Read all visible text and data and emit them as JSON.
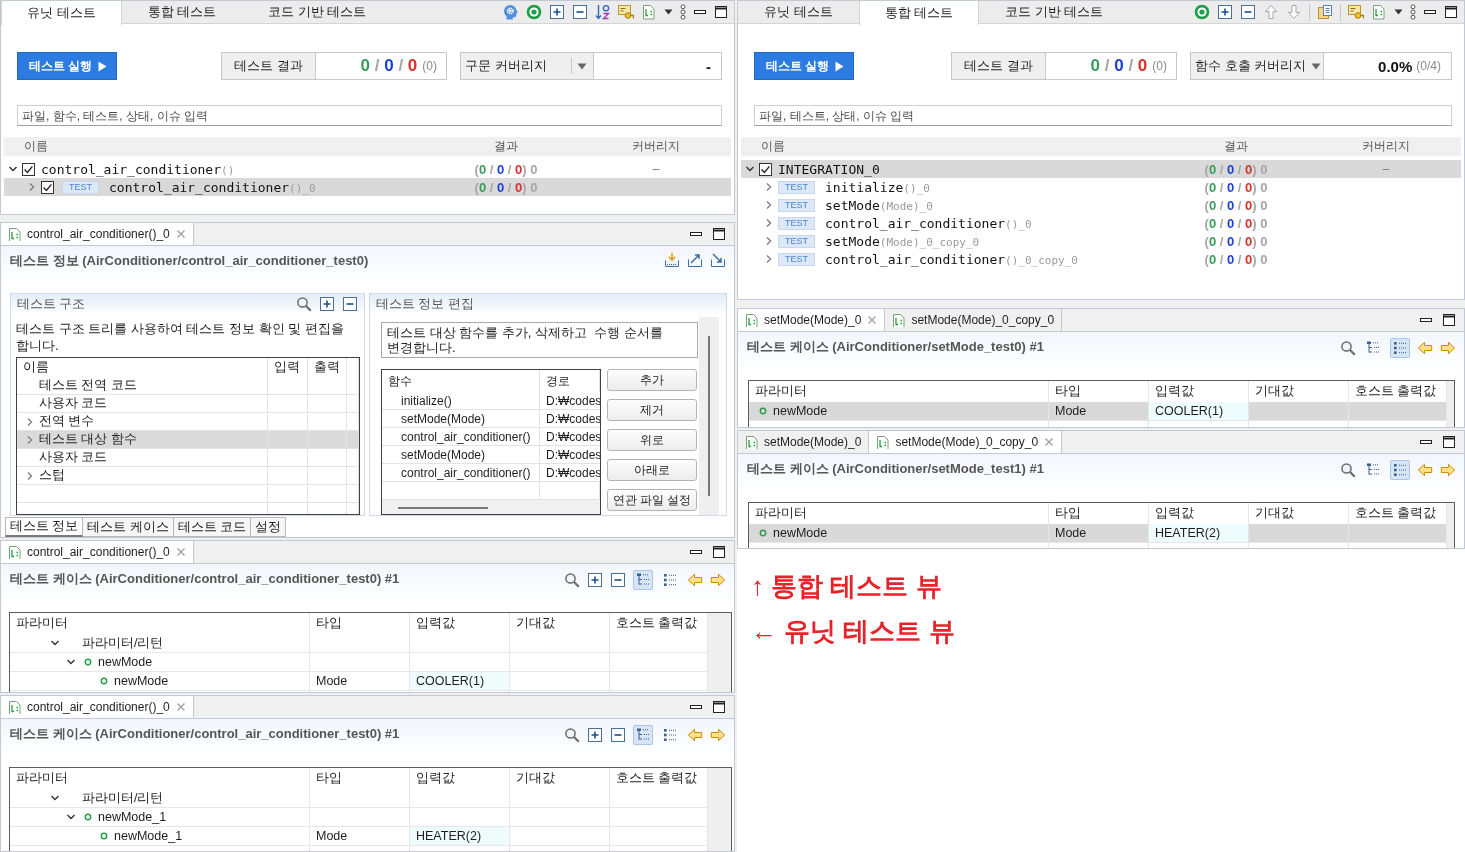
{
  "unit_view": {
    "tabs": [
      {
        "label": "유닛 테스트",
        "selected": true
      },
      {
        "label": "통합 테스트",
        "selected": false
      },
      {
        "label": "코드 기반 테스트",
        "selected": false
      }
    ],
    "run_button": "테스트 실행",
    "result": {
      "label": "테스트 결과",
      "counts": [
        {
          "text": "0",
          "color": "#3a9b5b"
        },
        {
          "text": " / ",
          "color": "#a6a6a6"
        },
        {
          "text": "0",
          "color": "#1d3fd6"
        },
        {
          "text": " / ",
          "color": "#a6a6a6"
        },
        {
          "text": "0",
          "color": "#d8312d"
        }
      ],
      "total": "(0)"
    },
    "coverage": {
      "label": "구문 커버리지",
      "value": "-"
    },
    "search": {
      "placeholder": "파일, 함수, 테스트, 상태, 이슈 입력"
    },
    "tree": {
      "columns": [
        "이름",
        "결과",
        "커버리지"
      ],
      "rows": [
        {
          "name": "control_air_conditioner",
          "suffix": "()",
          "checked": true,
          "expanded": true,
          "selected": false,
          "result": [
            {
              "text": "(",
              "color": "#a6a6a6"
            },
            {
              "text": "0",
              "color": "#3a9b5b"
            },
            {
              "text": " / ",
              "color": "#a6a6a6"
            },
            {
              "text": "0",
              "color": "#1d3fd6"
            },
            {
              "text": " / ",
              "color": "#a6a6a6"
            },
            {
              "text": "0",
              "color": "#d8312d"
            },
            {
              "text": ") 0",
              "color": "#a6a6a6"
            }
          ],
          "coverage": "–",
          "children": [
            {
              "badge": "TEST",
              "name": "control_air_conditioner",
              "suffix": "()_0",
              "checked": true,
              "expanded": false,
              "selected": true,
              "result": [
                {
                  "text": "(",
                  "color": "#a6a6a6"
                },
                {
                  "text": "0",
                  "color": "#3a9b5b"
                },
                {
                  "text": " / ",
                  "color": "#a6a6a6"
                },
                {
                  "text": "0",
                  "color": "#1d3fd6"
                },
                {
                  "text": " / ",
                  "color": "#a6a6a6"
                },
                {
                  "text": "0",
                  "color": "#d8312d"
                },
                {
                  "text": ") 0",
                  "color": "#a6a6a6"
                }
              ]
            }
          ]
        }
      ]
    }
  },
  "test_info_editor": {
    "tabs": [
      {
        "label": "control_air_conditioner()_0",
        "selected": true
      }
    ],
    "title": "테스트 정보 (AirConditioner/control_air_conditioner_test0)",
    "structure": {
      "title": "테스트 구조",
      "description": "테스트 구조 트리를 사용하여 테스트 정보 확인 및 편집을 합니다.",
      "columns": [
        "이름",
        "입력",
        "출력"
      ],
      "rows": [
        {
          "label": "테스트 전역 코드",
          "selected": false
        },
        {
          "label": "사용자 코드",
          "selected": false
        },
        {
          "label": "전역 변수",
          "expanded": false,
          "selected": false
        },
        {
          "label": "테스트 대상 함수",
          "expanded": false,
          "selected": true
        },
        {
          "label": "사용자 코드",
          "selected": false
        },
        {
          "label": "스텁",
          "expanded": false,
          "selected": false
        }
      ]
    },
    "edit": {
      "title": "테스트 정보 편집",
      "description": "테스트 대상 함수를 추가, 삭제하고  수행 순서를 변경합니다.",
      "columns": [
        "함수",
        "경로"
      ],
      "rows": [
        {
          "function": "initialize()",
          "path": "D:₩codes"
        },
        {
          "function": "setMode(Mode)",
          "path": "D:₩codes"
        },
        {
          "function": "control_air_conditioner()",
          "path": "D:₩codes"
        },
        {
          "function": "setMode(Mode)",
          "path": "D:₩codes"
        },
        {
          "function": "control_air_conditioner()",
          "path": "D:₩codes"
        }
      ],
      "buttons": [
        "추가",
        "제거",
        "위로",
        "아래로",
        "연관 파일 설정"
      ]
    },
    "bottom_tabs": [
      {
        "label": "테스트 정보",
        "selected": true
      },
      {
        "label": "테스트 케이스",
        "selected": false
      },
      {
        "label": "테스트 코드",
        "selected": false
      },
      {
        "label": "설정",
        "selected": false
      }
    ]
  },
  "unit_case_editors": [
    {
      "tabs": [
        {
          "label": "control_air_conditioner()_0",
          "selected": true
        }
      ],
      "title": "테스트 케이스 (AirConditioner/control_air_conditioner_test0) #1",
      "view_buttons": [
        {
          "selected": true
        },
        {
          "selected": false
        }
      ],
      "columns": [
        "파라미터",
        "타입",
        "입력값",
        "기대값",
        "호스트 출력값"
      ],
      "rows": [
        {
          "kind": "group",
          "label": "파라미터/리턴",
          "expanded": true,
          "selected": false,
          "children": [
            {
              "kind": "param",
              "label": "newMode",
              "expanded": true,
              "selected": false,
              "children": [
                {
                  "kind": "param",
                  "label": "newMode",
                  "type": "Mode",
                  "input": "COOLER(1)",
                  "selected": false
                }
              ]
            }
          ]
        }
      ]
    },
    {
      "tabs": [
        {
          "label": "control_air_conditioner()_0",
          "selected": true
        }
      ],
      "title": "테스트 케이스 (AirConditioner/control_air_conditioner_test0) #1",
      "view_buttons": [
        {
          "selected": true
        },
        {
          "selected": false
        }
      ],
      "columns": [
        "파라미터",
        "타입",
        "입력값",
        "기대값",
        "호스트 출력값"
      ],
      "rows": [
        {
          "kind": "group",
          "label": "파라미터/리턴",
          "expanded": true,
          "selected": false,
          "children": [
            {
              "kind": "param",
              "label": "newMode_1",
              "expanded": true,
              "selected": false,
              "children": [
                {
                  "kind": "param",
                  "label": "newMode_1",
                  "type": "Mode",
                  "input": "HEATER(2)",
                  "selected": false
                }
              ]
            }
          ]
        }
      ]
    }
  ],
  "integration_view": {
    "tabs": [
      {
        "label": "유닛 테스트",
        "selected": false
      },
      {
        "label": "통합 테스트",
        "selected": true
      },
      {
        "label": "코드 기반 테스트",
        "selected": false
      }
    ],
    "run_button": "테스트 실행",
    "result": {
      "label": "테스트 결과",
      "counts": [
        {
          "text": "0",
          "color": "#3a9b5b"
        },
        {
          "text": " / ",
          "color": "#a6a6a6"
        },
        {
          "text": "0",
          "color": "#1d3fd6"
        },
        {
          "text": " / ",
          "color": "#a6a6a6"
        },
        {
          "text": "0",
          "color": "#d8312d"
        }
      ],
      "total": "(0)"
    },
    "coverage": {
      "label": "함수 호출 커버리지",
      "value": "0.0%",
      "detail": "(0/4)"
    },
    "search": {
      "placeholder": "파일, 테스트, 상태, 이슈 입력"
    },
    "tree": {
      "columns": [
        "이름",
        "결과",
        "커버리지"
      ],
      "rows": [
        {
          "name": "INTEGRATION_0",
          "checked": true,
          "expanded": true,
          "selected": true,
          "result": [
            {
              "text": "(",
              "color": "#a6a6a6"
            },
            {
              "text": "0",
              "color": "#3a9b5b"
            },
            {
              "text": " / ",
              "color": "#a6a6a6"
            },
            {
              "text": "0",
              "color": "#1d3fd6"
            },
            {
              "text": " / ",
              "color": "#a6a6a6"
            },
            {
              "text": "0",
              "color": "#d8312d"
            },
            {
              "text": ") 0",
              "color": "#a6a6a6"
            }
          ],
          "coverage": "–",
          "children": [
            {
              "badge": "TEST",
              "name": "initialize",
              "suffix": "()_0",
              "expanded": false,
              "selected": false,
              "result": [
                {
                  "text": "(",
                  "color": "#a6a6a6"
                },
                {
                  "text": "0",
                  "color": "#3a9b5b"
                },
                {
                  "text": " / ",
                  "color": "#a6a6a6"
                },
                {
                  "text": "0",
                  "color": "#1d3fd6"
                },
                {
                  "text": " / ",
                  "color": "#a6a6a6"
                },
                {
                  "text": "0",
                  "color": "#d8312d"
                },
                {
                  "text": ") 0",
                  "color": "#a6a6a6"
                }
              ]
            },
            {
              "badge": "TEST",
              "name": "setMode",
              "suffix": "(Mode)_0",
              "expanded": false,
              "selected": false,
              "result": [
                {
                  "text": "(",
                  "color": "#a6a6a6"
                },
                {
                  "text": "0",
                  "color": "#3a9b5b"
                },
                {
                  "text": " / ",
                  "color": "#a6a6a6"
                },
                {
                  "text": "0",
                  "color": "#1d3fd6"
                },
                {
                  "text": " / ",
                  "color": "#a6a6a6"
                },
                {
                  "text": "0",
                  "color": "#d8312d"
                },
                {
                  "text": ") 0",
                  "color": "#a6a6a6"
                }
              ]
            },
            {
              "badge": "TEST",
              "name": "control_air_conditioner",
              "suffix": "()_0",
              "expanded": false,
              "selected": false,
              "result": [
                {
                  "text": "(",
                  "color": "#a6a6a6"
                },
                {
                  "text": "0",
                  "color": "#3a9b5b"
                },
                {
                  "text": " / ",
                  "color": "#a6a6a6"
                },
                {
                  "text": "0",
                  "color": "#1d3fd6"
                },
                {
                  "text": " / ",
                  "color": "#a6a6a6"
                },
                {
                  "text": "0",
                  "color": "#d8312d"
                },
                {
                  "text": ") 0",
                  "color": "#a6a6a6"
                }
              ]
            },
            {
              "badge": "TEST",
              "name": "setMode",
              "suffix": "(Mode)_0_copy_0",
              "expanded": false,
              "selected": false,
              "result": [
                {
                  "text": "(",
                  "color": "#a6a6a6"
                },
                {
                  "text": "0",
                  "color": "#3a9b5b"
                },
                {
                  "text": " / ",
                  "color": "#a6a6a6"
                },
                {
                  "text": "0",
                  "color": "#1d3fd6"
                },
                {
                  "text": " / ",
                  "color": "#a6a6a6"
                },
                {
                  "text": "0",
                  "color": "#d8312d"
                },
                {
                  "text": ") 0",
                  "color": "#a6a6a6"
                }
              ]
            },
            {
              "badge": "TEST",
              "name": "control_air_conditioner",
              "suffix": "()_0_copy_0",
              "expanded": false,
              "selected": false,
              "result": [
                {
                  "text": "(",
                  "color": "#a6a6a6"
                },
                {
                  "text": "0",
                  "color": "#3a9b5b"
                },
                {
                  "text": " / ",
                  "color": "#a6a6a6"
                },
                {
                  "text": "0",
                  "color": "#1d3fd6"
                },
                {
                  "text": " / ",
                  "color": "#a6a6a6"
                },
                {
                  "text": "0",
                  "color": "#d8312d"
                },
                {
                  "text": ") 0",
                  "color": "#a6a6a6"
                }
              ]
            }
          ]
        }
      ]
    }
  },
  "integration_case_editors": [
    {
      "tabs": [
        {
          "label": "setMode(Mode)_0",
          "selected": true
        },
        {
          "label": "setMode(Mode)_0_copy_0",
          "selected": false
        }
      ],
      "title": "테스트 케이스 (AirConditioner/setMode_test0) #1",
      "view_buttons": [
        {
          "selected": false
        },
        {
          "selected": true
        }
      ],
      "columns": [
        "파라미터",
        "타입",
        "입력값",
        "기대값",
        "호스트 출력값"
      ],
      "rows": [
        {
          "kind": "param",
          "label": "newMode",
          "type": "Mode",
          "input": "COOLER(1)",
          "selected": true
        }
      ]
    },
    {
      "tabs": [
        {
          "label": "setMode(Mode)_0",
          "selected": false
        },
        {
          "label": "setMode(Mode)_0_copy_0",
          "selected": true
        }
      ],
      "title": "테스트 케이스 (AirConditioner/setMode_test1) #1",
      "view_buttons": [
        {
          "selected": false
        },
        {
          "selected": true
        }
      ],
      "columns": [
        "파라미터",
        "타입",
        "입력값",
        "기대값",
        "호스트 출력값"
      ],
      "rows": [
        {
          "kind": "param",
          "label": "newMode",
          "type": "Mode",
          "input": "HEATER(2)",
          "selected": true
        }
      ]
    }
  ],
  "annotations": [
    "↑ 통합 테스트 뷰",
    "← 유닛 테스트 뷰"
  ]
}
